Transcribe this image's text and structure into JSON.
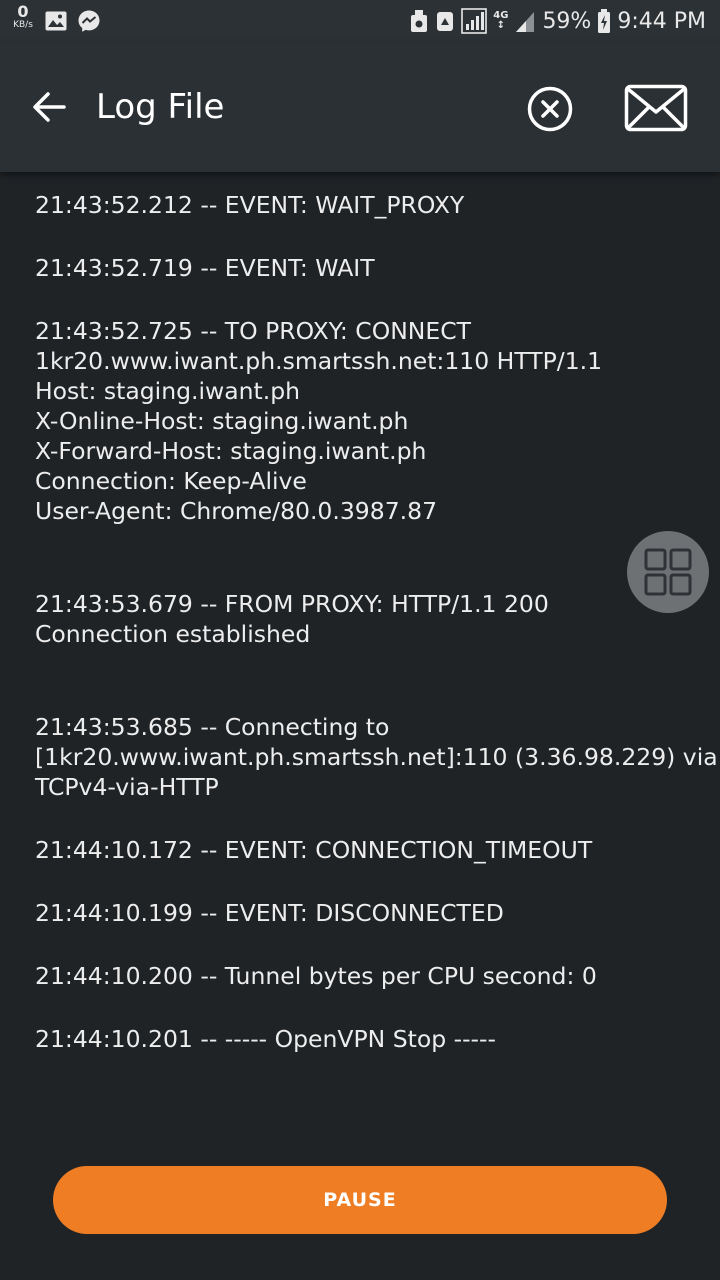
{
  "status_bar": {
    "speed_value": "0",
    "speed_unit": "KB/s",
    "battery_percent": "59%",
    "time": "9:44 PM",
    "network_type": "4G",
    "left_icons": [
      "image-icon",
      "messenger-icon"
    ],
    "right_icons": [
      "cleaner-icon",
      "shield-icon",
      "signal-icon",
      "signal-icon",
      "battery-icon"
    ]
  },
  "app_bar": {
    "title": "Log File",
    "back_icon": "arrow-left-icon",
    "clear_icon": "clear-circle-icon",
    "mail_icon": "mail-icon"
  },
  "log": {
    "entries": [
      {
        "lines": [
          "21:43:52.212 -- EVENT: WAIT_PROXY"
        ]
      },
      {
        "lines": [
          "21:43:52.719 -- EVENT: WAIT"
        ]
      },
      {
        "lines": [
          "21:43:52.725 -- TO PROXY: CONNECT",
          "1kr20.www.iwant.ph.smartssh.net:110 HTTP/1.1",
          "Host: staging.iwant.ph",
          "X-Online-Host: staging.iwant.ph",
          "X-Forward-Host: staging.iwant.ph",
          "Connection: Keep-Alive",
          "User-Agent: Chrome/80.0.3987.87"
        ]
      },
      {
        "lines": [
          "21:43:53.679 -- FROM PROXY: HTTP/1.1 200",
          "Connection established"
        ]
      },
      {
        "lines": [
          "21:43:53.685 -- Connecting to",
          "[1kr20.www.iwant.ph.smartssh.net]:110 (3.36.98.229) via",
          "TCPv4-via-HTTP"
        ]
      },
      {
        "lines": [
          "21:44:10.172 -- EVENT: CONNECTION_TIMEOUT"
        ]
      },
      {
        "lines": [
          "21:44:10.199 -- EVENT: DISCONNECTED"
        ]
      },
      {
        "lines": [
          "21:44:10.200 -- Tunnel bytes per CPU second: 0"
        ]
      },
      {
        "lines": [
          "21:44:10.201 -- ----- OpenVPN Stop -----"
        ]
      }
    ]
  },
  "floating_button": {
    "icon": "grid-icon"
  },
  "pause_button": {
    "label": "PAUSE",
    "color": "#ee7d24"
  },
  "colors": {
    "background": "#1f2326",
    "app_bar": "#2b3034",
    "status_bar": "#2c3135",
    "text": "#ededed",
    "accent": "#ee7d24"
  }
}
